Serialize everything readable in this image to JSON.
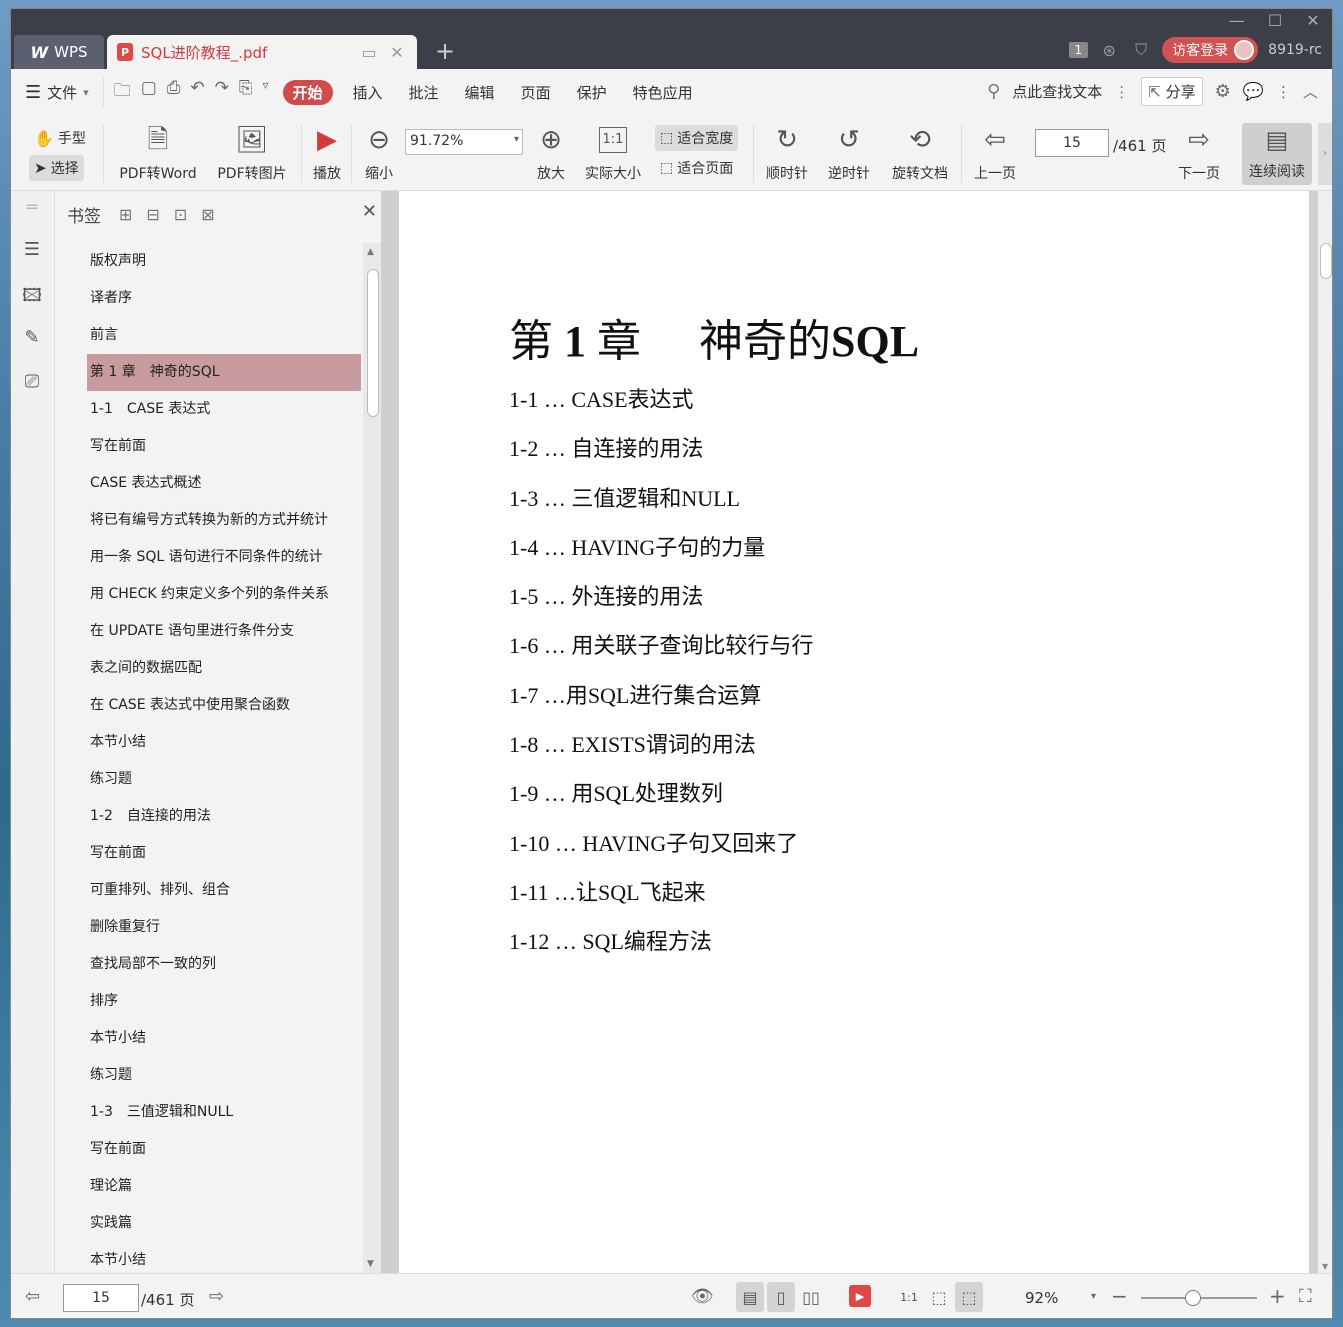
{
  "titlebar": {
    "app_tab": "WPS",
    "app_logo": "W",
    "doc_tab_title": "SQL进阶教程_.pdf",
    "pdf_icon": "P",
    "badge": "1",
    "login_label": "访客登录",
    "user_id": "8919-rc"
  },
  "menubar": {
    "file_label": "文件",
    "items": [
      "开始",
      "插入",
      "批注",
      "编辑",
      "页面",
      "保护",
      "特色应用"
    ],
    "search_label": "点此查找文本",
    "share_label": "分享"
  },
  "toolbar": {
    "hand": "手型",
    "select": "选择",
    "pdf_to_word": "PDF转Word",
    "pdf_to_image": "PDF转图片",
    "play": "播放",
    "zoom_out": "缩小",
    "zoom_value": "91.72%",
    "zoom_in": "放大",
    "actual_size": "实际大小",
    "actual_size_icon": "1:1",
    "fit_width": "适合宽度",
    "fit_page": "适合页面",
    "clockwise": "顺时针",
    "counter_clockwise": "逆时针",
    "rotate_doc": "旋转文档",
    "prev_page": "上一页",
    "page_value": "15",
    "page_total": "/461 页",
    "next_page": "下一页",
    "continuous_read": "连续阅读"
  },
  "bookmarks": {
    "title": "书签",
    "selected_index": 3,
    "items": [
      "版权声明",
      "译者序",
      "前言",
      "第 1 章　神奇的SQL",
      "1-1　CASE 表达式",
      "写在前面",
      "CASE 表达式概述",
      "将已有编号方式转换为新的方式并统计",
      "用一条 SQL 语句进行不同条件的统计",
      "用 CHECK 约束定义多个列的条件关系",
      "在 UPDATE 语句里进行条件分支",
      "表之间的数据匹配",
      "在 CASE 表达式中使用聚合函数",
      "本节小结",
      "练习题",
      "1-2　自连接的用法",
      "写在前面",
      "可重排列、排列、组合",
      "删除重复行",
      "查找局部不一致的列",
      "排序",
      "本节小结",
      "练习题",
      "1-3　三值逻辑和NULL",
      "写在前面",
      "理论篇",
      "实践篇",
      "本节小结"
    ]
  },
  "document": {
    "chapter_prefix": "第",
    "chapter_num": "1",
    "chapter_suffix": "章",
    "chapter_title_cn": "神奇的",
    "chapter_title_en": "SQL",
    "toc": [
      "1-1 … CASE表达式",
      "1-2 … 自连接的用法",
      "1-3 … 三值逻辑和NULL",
      "1-4 … HAVING子句的力量",
      "1-5 … 外连接的用法",
      "1-6 … 用关联子查询比较行与行",
      "1-7 …用SQL进行集合运算",
      "1-8 … EXISTS谓词的用法",
      "1-9 … 用SQL处理数列",
      "1-10 … HAVING子句又回来了",
      "1-11 …让SQL飞起来",
      "1-12 … SQL编程方法"
    ]
  },
  "statusbar": {
    "page_value": "15",
    "page_total": "/461 页",
    "zoom_value": "92%",
    "zoom_fraction": 0.45,
    "view_actual_icon": "1:1"
  }
}
